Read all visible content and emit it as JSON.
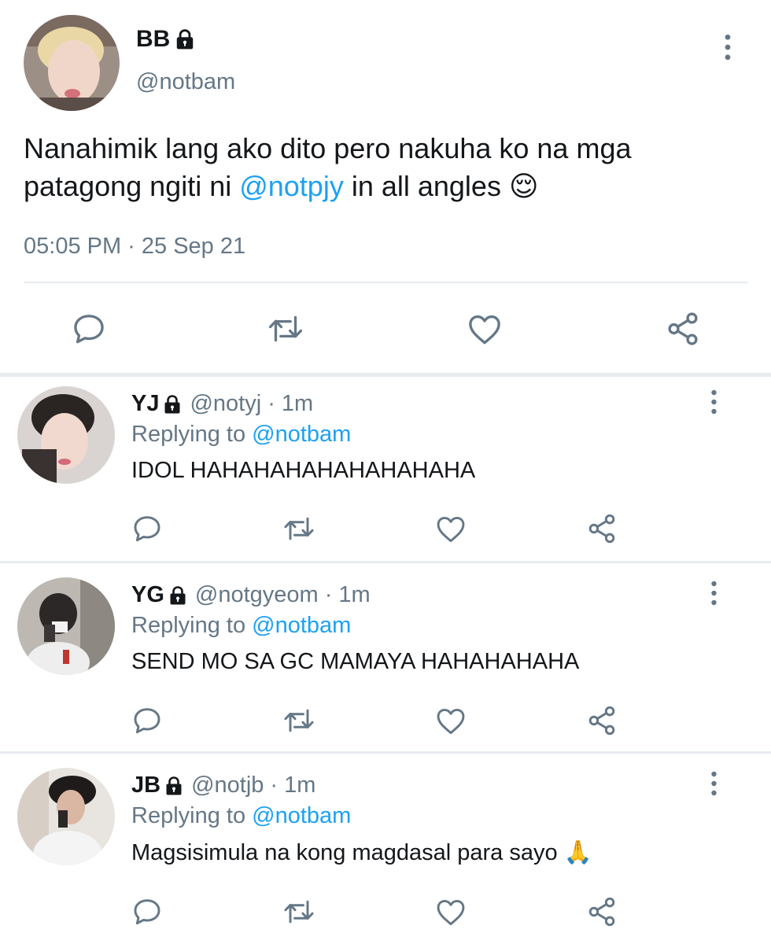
{
  "main_tweet": {
    "name": "BB",
    "handle": "@notbam",
    "text_before": "Nanahimik lang ako dito pero nakuha ko na mga patagong ngiti ni ",
    "mention": "@notpjy",
    "text_after": " in all angles",
    "emoji": "😌",
    "timestamp": "05:05 PM · 25 Sep 21"
  },
  "replies": [
    {
      "name": "YJ",
      "handle": "@notyj",
      "dot": "·",
      "time": "1m",
      "replying_prefix": "Replying to ",
      "replying_to": "@notbam",
      "text": "IDOL HAHAHAHAHAHAHAHAHA"
    },
    {
      "name": "YG",
      "handle": "@notgyeom",
      "dot": "·",
      "time": "1m",
      "replying_prefix": "Replying to ",
      "replying_to": "@notbam",
      "text": "SEND MO SA GC MAMAYA HAHAHAHAHA"
    },
    {
      "name": "JB",
      "handle": "@notjb",
      "dot": "·",
      "time": "1m",
      "replying_prefix": "Replying to ",
      "replying_to": "@notbam",
      "text": "Magsisimula na kong magdasal para sayo 🙏"
    }
  ],
  "icons": {
    "reply": "reply-icon",
    "retweet": "retweet-icon",
    "like": "like-icon",
    "share": "share-icon",
    "more": "more-vertical-icon",
    "lock": "lock-icon"
  },
  "colors": {
    "text": "#14171a",
    "secondary": "#657786",
    "link": "#1da1f2",
    "divider": "#e6ecf0",
    "icon": "#657786"
  }
}
